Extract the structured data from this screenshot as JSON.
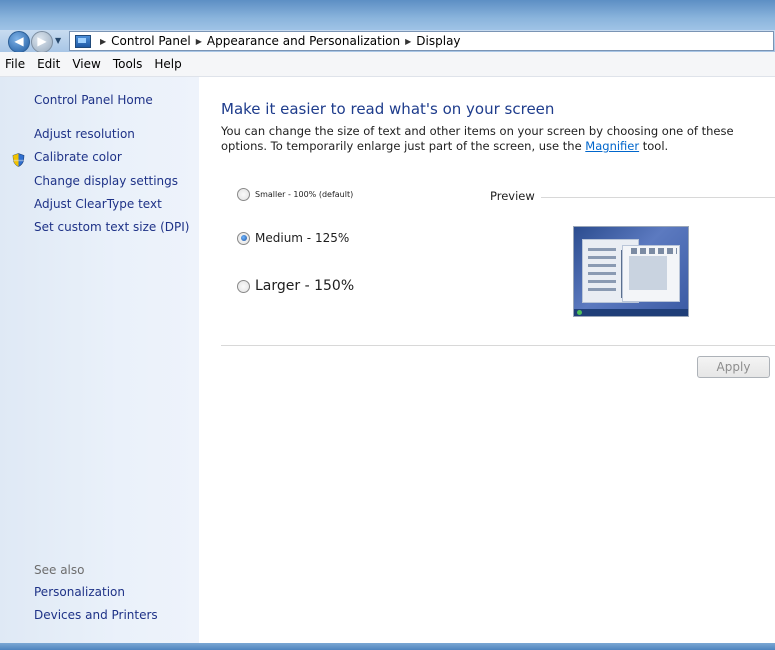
{
  "address_bar": {
    "crumbs": [
      "Control Panel",
      "Appearance and Personalization",
      "Display"
    ]
  },
  "menu": [
    "File",
    "Edit",
    "View",
    "Tools",
    "Help"
  ],
  "sidebar": {
    "home": "Control Panel Home",
    "links": [
      "Adjust resolution",
      "Calibrate color",
      "Change display settings",
      "Adjust ClearType text",
      "Set custom text size (DPI)"
    ],
    "see_also_label": "See also",
    "see_also": [
      "Personalization",
      "Devices and Printers"
    ]
  },
  "main": {
    "heading": "Make it easier to read what's on your screen",
    "description_pre": "You can change the size of text and other items on your screen by choosing one of these options. To temporarily enlarge just part of the screen, use the ",
    "description_link": "Magnifier",
    "description_post": " tool.",
    "options": [
      {
        "label": "Smaller - 100% (default)",
        "selected": false
      },
      {
        "label": "Medium - 125%",
        "selected": true
      },
      {
        "label": "Larger - 150%",
        "selected": false
      }
    ],
    "preview_label": "Preview",
    "apply_label": "Apply"
  },
  "colors": {
    "link": "#1e3287",
    "heading": "#1e3c8c",
    "sidebar_bg": "#e3ecf7"
  }
}
